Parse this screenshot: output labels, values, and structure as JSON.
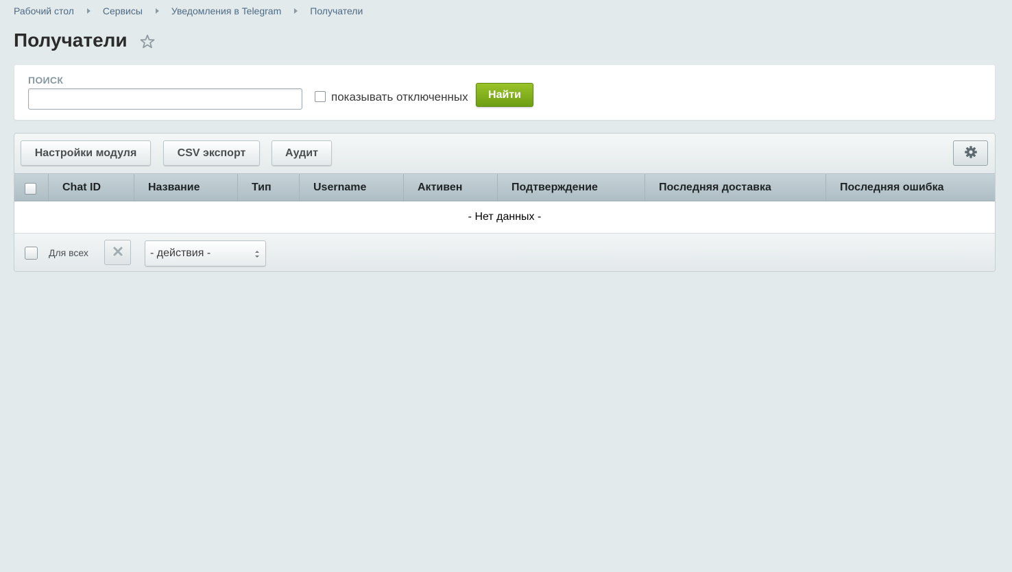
{
  "breadcrumb": {
    "items": [
      "Рабочий стол",
      "Сервисы",
      "Уведомления в Telegram",
      "Получатели"
    ]
  },
  "page": {
    "title": "Получатели",
    "favorite_icon": "star-icon"
  },
  "search": {
    "label": "ПОИСК",
    "value": "",
    "placeholder": "",
    "show_disabled_label": "показывать отключенных",
    "show_disabled_checked": false,
    "find_button": "Найти"
  },
  "toolbar": {
    "buttons": [
      "Настройки модуля",
      "CSV экспорт",
      "Аудит"
    ],
    "settings_icon": "gear-icon"
  },
  "grid": {
    "columns": [
      "Chat ID",
      "Название",
      "Тип",
      "Username",
      "Активен",
      "Подтверждение",
      "Последняя доставка",
      "Последняя ошибка"
    ],
    "rows": [],
    "empty_text": "- Нет данных -"
  },
  "footer": {
    "for_all_label": "Для всех",
    "delete_icon": "close-icon",
    "actions_value": "- действия -"
  },
  "colors": {
    "background": "#e2eaec",
    "link": "#4e6b85",
    "accent_green": "#7ba818"
  }
}
